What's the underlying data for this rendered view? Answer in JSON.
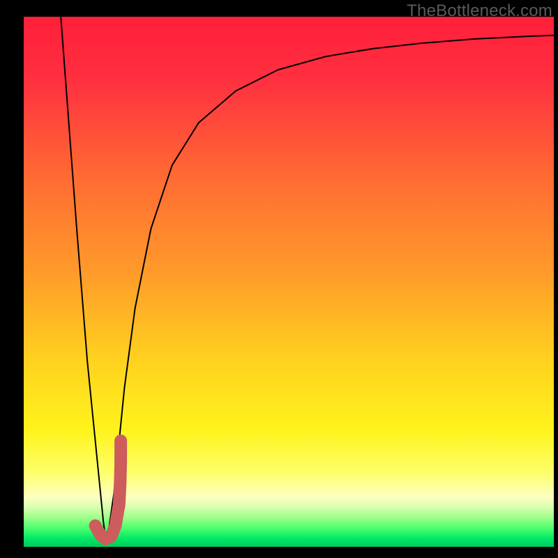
{
  "watermark": "TheBottleneck.com",
  "chart_data": {
    "type": "line",
    "title": "",
    "xlabel": "",
    "ylabel": "",
    "xlim": [
      0,
      100
    ],
    "ylim": [
      0,
      100
    ],
    "grid": false,
    "legend": false,
    "series": [
      {
        "name": "curve",
        "stroke": "#000000",
        "x": [
          7,
          10,
          12,
          14,
          15,
          15.5,
          16,
          17,
          18,
          19,
          21,
          24,
          28,
          33,
          40,
          48,
          57,
          66,
          75,
          85,
          95,
          100
        ],
        "values": [
          100,
          60,
          35,
          15,
          5,
          1,
          3,
          10,
          20,
          30,
          45,
          60,
          72,
          80,
          86,
          90,
          92.5,
          94,
          95,
          95.8,
          96.3,
          96.5
        ]
      },
      {
        "name": "j-mark",
        "stroke": "#cd5c5c",
        "x": [
          13.5,
          14.5,
          15.5,
          16.5,
          17.3,
          18.0,
          18.2,
          18.3,
          18.3
        ],
        "values": [
          4.0,
          2.2,
          1.5,
          2.0,
          4.0,
          8.0,
          12.0,
          16.0,
          20.0
        ]
      }
    ],
    "background": {
      "gradient_stops": [
        {
          "pos": 0.0,
          "color": "#ff1f3a"
        },
        {
          "pos": 0.12,
          "color": "#ff3040"
        },
        {
          "pos": 0.3,
          "color": "#ff6a33"
        },
        {
          "pos": 0.48,
          "color": "#ff9a2a"
        },
        {
          "pos": 0.65,
          "color": "#ffd21f"
        },
        {
          "pos": 0.78,
          "color": "#fff31c"
        },
        {
          "pos": 0.86,
          "color": "#fdff6a"
        },
        {
          "pos": 0.905,
          "color": "#feffc0"
        },
        {
          "pos": 0.925,
          "color": "#d9ffb0"
        },
        {
          "pos": 0.945,
          "color": "#9dff8a"
        },
        {
          "pos": 0.965,
          "color": "#4bff6e"
        },
        {
          "pos": 0.985,
          "color": "#00e765"
        },
        {
          "pos": 1.0,
          "color": "#00c85d"
        }
      ]
    }
  }
}
